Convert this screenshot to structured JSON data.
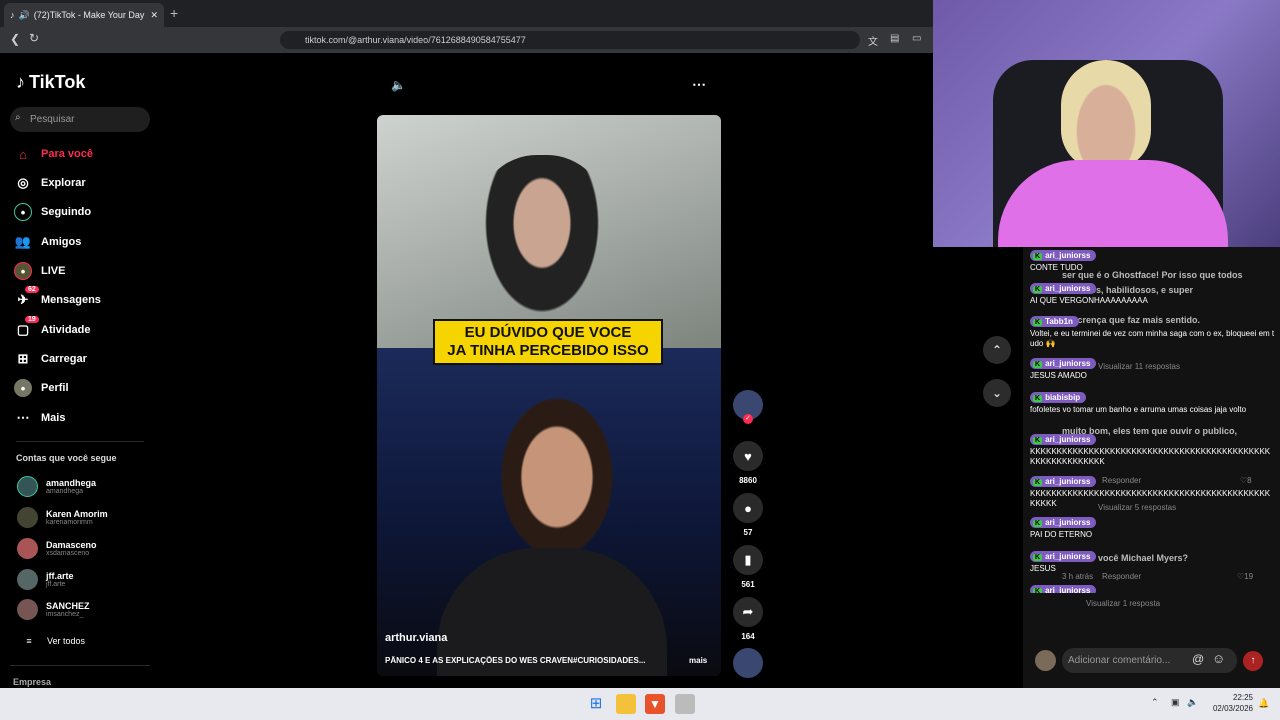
{
  "browser": {
    "tab_title": "(72)TikTok - Make Your Day",
    "new_tab": "+",
    "url": "tiktok.com/@arthur.viana/video/7612688490584755477"
  },
  "sidebar": {
    "logo": "TikTok",
    "search_placeholder": "Pesquisar",
    "items": [
      {
        "label": "Para você",
        "icon": "home-icon",
        "active": true
      },
      {
        "label": "Explorar",
        "icon": "compass-icon"
      },
      {
        "label": "Seguindo",
        "icon": "following-icon"
      },
      {
        "label": "Amigos",
        "icon": "friends-icon"
      },
      {
        "label": "LIVE",
        "icon": "live-icon"
      },
      {
        "label": "Mensagens",
        "icon": "messages-icon",
        "badge": "62"
      },
      {
        "label": "Atividade",
        "icon": "activity-icon",
        "badge": "19"
      },
      {
        "label": "Carregar",
        "icon": "upload-icon"
      },
      {
        "label": "Perfil",
        "icon": "profile-icon"
      },
      {
        "label": "Mais",
        "icon": "more-icon"
      }
    ],
    "following_title": "Contas que você segue",
    "accounts": [
      {
        "name": "amandhega",
        "handle": "amandhega"
      },
      {
        "name": "Karen Amorim",
        "handle": "karenamorimm"
      },
      {
        "name": "Damasceno",
        "handle": "xsdamasceno"
      },
      {
        "name": "jff.arte",
        "handle": "jff.arte"
      },
      {
        "name": "SANCHEZ",
        "handle": "imsanchez_"
      }
    ],
    "see_all": "Ver todos",
    "company": "Empresa"
  },
  "video": {
    "caption_line1": "EU DÚVIDO QUE VOCE",
    "caption_line2": "JA TINHA PERCEBIDO ISSO",
    "author": "arthur.viana",
    "description": "PÂNICO 4 E AS EXPLICAÇÕES DO WES CRAVEN#CURIOSIDADES...",
    "more": "mais",
    "likes": "8860",
    "comments": "57",
    "saves": "561",
    "shares": "164"
  },
  "chat": [
    {
      "user": "ari_juniorss",
      "text": "CONTE TUDO"
    },
    {
      "user": "ari_juniorss",
      "text": "AI QUE VERGONHAAAAAAAAA"
    },
    {
      "user": "Tabb1n",
      "text": "Voltei, e eu terminei de vez com minha saga com o ex, bloqueei em tudo 🙌"
    },
    {
      "user": "ari_juniorss",
      "text": "JESUS AMADO"
    },
    {
      "user": "biabisbip",
      "text": "fofoletes vo tomar um banho e arruma umas coisas jaja volto"
    },
    {
      "user": "ari_juniorss",
      "text": "KKKKKKKKKKKKKKKKKKKKKKKKKKKKKKKKKKKKKKKKKKKKKKKKKKKKKKKKKKK"
    },
    {
      "user": "ari_juniorss",
      "text": "KKKKKKKKKKKKKKKKKKKKKKKKKKKKKKKKKKKKKKKKKKKKKKKKKK"
    },
    {
      "user": "ari_juniorss",
      "text": "PAI DO ETERNO"
    },
    {
      "user": "ari_juniorss",
      "text": "JESUS"
    },
    {
      "user": "ari_juniorss",
      "text": ""
    }
  ],
  "comments_bg": {
    "line1": "ser que é o Ghostface! Por isso que todos",
    "line2": "são altos, habilidosos, e super",
    "line3": "descrença que faz mais sentido.",
    "view_replies_11": "Visualizar 11 respostas",
    "line4": "muito bom, eles tem que ouvir o publico,",
    "responder": "Responder",
    "likes_8": "8",
    "view_replies_5": "Visualizar 5 respostas",
    "line5": "você Michael Myers?",
    "time": "3 h atrás",
    "likes_19": "19",
    "view_replies_1": "Visualizar 1 resposta",
    "input_placeholder": "Adicionar comentário..."
  },
  "taskbar": {
    "time": "22:25",
    "date": "02/03/2026"
  },
  "colors": {
    "accent": "#fe2c55",
    "chat_name_bg": "#7d5bbf",
    "caption_yellow": "#f5d400"
  }
}
